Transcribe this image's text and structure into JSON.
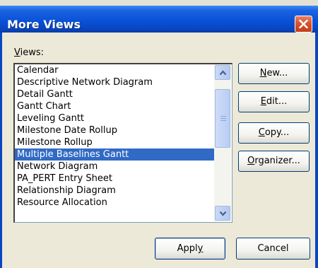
{
  "dialog": {
    "title": "More Views",
    "views_label_key": "V",
    "views_label_rest": "iews:"
  },
  "views_list": {
    "items": [
      "Calendar",
      "Descriptive Network Diagram",
      "Detail Gantt",
      "Gantt Chart",
      "Leveling Gantt",
      "Milestone Date Rollup",
      "Milestone Rollup",
      "Multiple Baselines Gantt",
      "Network Diagram",
      "PA_PERT Entry Sheet",
      "Relationship Diagram",
      "Resource Allocation"
    ],
    "selected": "Multiple Baselines Gantt",
    "scroll_position": 0.05
  },
  "buttons": {
    "new": {
      "key": "N",
      "rest": "ew..."
    },
    "edit": {
      "key": "E",
      "rest": "dit..."
    },
    "copy": {
      "key": "C",
      "rest": "opy..."
    },
    "organizer": {
      "key": "O",
      "rest": "rganizer..."
    },
    "apply": {
      "pre": "Appl",
      "key": "y"
    },
    "cancel": "Cancel"
  },
  "icons": {
    "close": "close-icon",
    "scroll_up": "scroll-up-arrow-icon",
    "scroll_down": "scroll-down-arrow-icon"
  },
  "colors": {
    "titlebar": "#0a52d8",
    "dialog_bg": "#ece9d8",
    "selection": "#316ac5",
    "close_button": "#d9542e"
  }
}
